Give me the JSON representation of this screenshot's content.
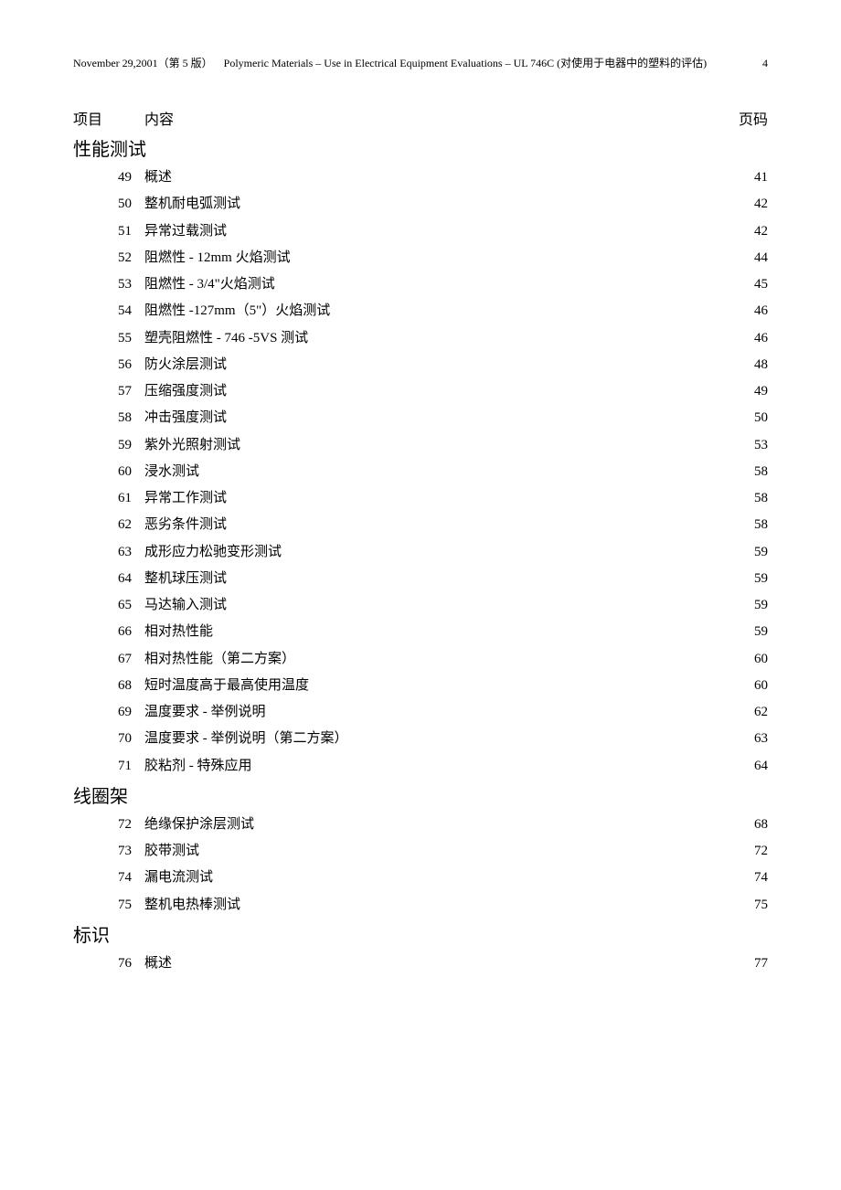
{
  "header": {
    "date": "November 29,2001（第 5 版）",
    "title": "Polymeric Materials – Use in Electrical Equipment Evaluations – UL 746C (对使用于电器中的塑料的评估)",
    "page_number": "4"
  },
  "columns": {
    "item": "项目",
    "content": "内容",
    "page": "页码"
  },
  "sections": [
    {
      "title": "性能测试",
      "rows": [
        {
          "num": "49",
          "content": "概述",
          "page": "41"
        },
        {
          "num": "50",
          "content": "整机耐电弧测试",
          "page": "42"
        },
        {
          "num": "51",
          "content": "异常过载测试",
          "page": "42"
        },
        {
          "num": "52",
          "content": "阻燃性  - 12mm 火焰测试",
          "page": "44"
        },
        {
          "num": "53",
          "content": "阻燃性  - 3/4\"火焰测试",
          "page": "45"
        },
        {
          "num": "54",
          "content": "阻燃性  -127mm（5\"）火焰测试",
          "page": "46"
        },
        {
          "num": "55",
          "content": "塑壳阻燃性  -   746 -5VS  测试",
          "page": "46"
        },
        {
          "num": "56",
          "content": "防火涂层测试",
          "page": "48"
        },
        {
          "num": "57",
          "content": "压缩强度测试",
          "page": "49"
        },
        {
          "num": "58",
          "content": "冲击强度测试",
          "page": "50"
        },
        {
          "num": "59",
          "content": "紫外光照射测试",
          "page": "53"
        },
        {
          "num": "60",
          "content": "浸水测试",
          "page": "58"
        },
        {
          "num": "61",
          "content": "异常工作测试",
          "page": "58"
        },
        {
          "num": "62",
          "content": "恶劣条件测试",
          "page": "58"
        },
        {
          "num": "63",
          "content": "成形应力松驰变形测试",
          "page": "59"
        },
        {
          "num": "64",
          "content": "整机球压测试",
          "page": "59"
        },
        {
          "num": "65",
          "content": "马达输入测试",
          "page": "59"
        },
        {
          "num": "66",
          "content": "相对热性能",
          "page": "59"
        },
        {
          "num": "67",
          "content": "相对热性能（第二方案）",
          "page": "60"
        },
        {
          "num": "68",
          "content": "短时温度高于最高使用温度",
          "page": "60"
        },
        {
          "num": "69",
          "content": "温度要求  -  举例说明",
          "page": "62"
        },
        {
          "num": "70",
          "content": "温度要求  -  举例说明（第二方案）",
          "page": "63"
        },
        {
          "num": "71",
          "content": "胶粘剂  -  特殊应用",
          "page": "64"
        }
      ]
    },
    {
      "title": "线圈架",
      "rows": [
        {
          "num": "72",
          "content": "绝缘保护涂层测试",
          "page": "68"
        },
        {
          "num": "73",
          "content": "胶带测试",
          "page": "72"
        },
        {
          "num": "74",
          "content": "漏电流测试",
          "page": "74"
        },
        {
          "num": "75",
          "content": "整机电热棒测试",
          "page": "75"
        }
      ]
    },
    {
      "title": "标识",
      "rows": [
        {
          "num": "76",
          "content": "概述",
          "page": "77"
        }
      ]
    }
  ]
}
